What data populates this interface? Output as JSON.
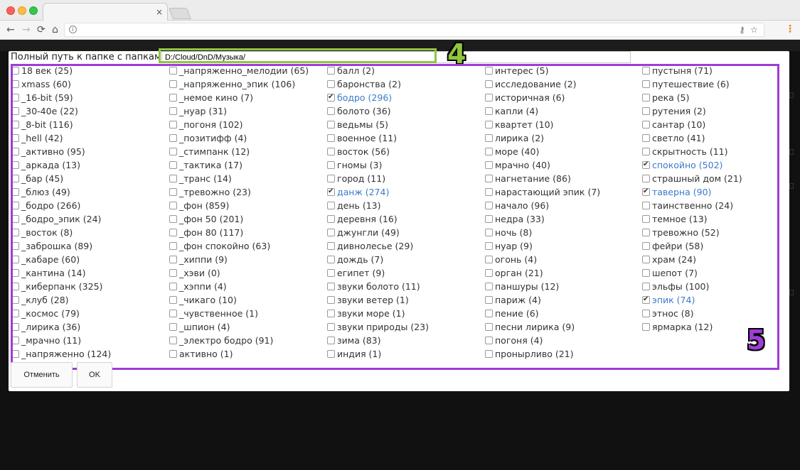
{
  "browser": {
    "tab_close": "×",
    "nav": {
      "back": "←",
      "forward": "→",
      "reload": "⟳",
      "home": "⌂"
    },
    "info": "i",
    "key_icon": "⚷",
    "star_icon": "☆",
    "menu_icon": "⋮"
  },
  "dialog": {
    "path_label": "Полный путь к папке с папками",
    "path_value": "D:/Cloud/DnD/Музыка/",
    "annotation_4": "4",
    "annotation_5": "5",
    "cancel_label": "Отменить",
    "ok_label": "OK",
    "annotation_colors": {
      "label4": "#8ec63f",
      "label5": "#9f3cd6"
    }
  },
  "columns": [
    [
      {
        "label": "18 век (25)",
        "checked": false
      },
      {
        "label": "xmass (60)",
        "checked": false
      },
      {
        "label": "_16-bit (59)",
        "checked": false
      },
      {
        "label": "_30-40е (22)",
        "checked": false
      },
      {
        "label": "_8-bit (116)",
        "checked": false
      },
      {
        "label": "_hell (42)",
        "checked": false
      },
      {
        "label": "_активно (95)",
        "checked": false
      },
      {
        "label": "_аркада (13)",
        "checked": false
      },
      {
        "label": "_бар (45)",
        "checked": false
      },
      {
        "label": "_блюз (49)",
        "checked": false
      },
      {
        "label": "_бодро (266)",
        "checked": false
      },
      {
        "label": "_бодро_эпик (24)",
        "checked": false
      },
      {
        "label": "_восток (8)",
        "checked": false
      },
      {
        "label": "_заброшка (89)",
        "checked": false
      },
      {
        "label": "_кабаре (60)",
        "checked": false
      },
      {
        "label": "_кантина (14)",
        "checked": false
      },
      {
        "label": "_киберпанк (325)",
        "checked": false
      },
      {
        "label": "_клуб (28)",
        "checked": false
      },
      {
        "label": "_космос (79)",
        "checked": false
      },
      {
        "label": "_лирика (36)",
        "checked": false
      },
      {
        "label": "_мрачно (11)",
        "checked": false
      },
      {
        "label": "_напряженно (124)",
        "checked": false
      }
    ],
    [
      {
        "label": "_напряженно_мелодии (65)",
        "checked": false
      },
      {
        "label": "_напряженно_эпик (106)",
        "checked": false
      },
      {
        "label": "_немое кино (7)",
        "checked": false
      },
      {
        "label": "_нуар (31)",
        "checked": false
      },
      {
        "label": "_погоня (102)",
        "checked": false
      },
      {
        "label": "_позитифф (4)",
        "checked": false
      },
      {
        "label": "_стимпанк (12)",
        "checked": false
      },
      {
        "label": "_тактика (17)",
        "checked": false
      },
      {
        "label": "_транс (14)",
        "checked": false
      },
      {
        "label": "_тревожно (23)",
        "checked": false
      },
      {
        "label": "_фон (859)",
        "checked": false
      },
      {
        "label": "_фон 50 (201)",
        "checked": false
      },
      {
        "label": "_фон 80 (117)",
        "checked": false
      },
      {
        "label": "_фон спокойно (63)",
        "checked": false
      },
      {
        "label": "_хиппи (9)",
        "checked": false
      },
      {
        "label": "_хэви (0)",
        "checked": false
      },
      {
        "label": "_хэппи (4)",
        "checked": false
      },
      {
        "label": "_чикаго (10)",
        "checked": false
      },
      {
        "label": "_чувственное (1)",
        "checked": false
      },
      {
        "label": "_шпион (4)",
        "checked": false
      },
      {
        "label": "_электро бодро (91)",
        "checked": false
      },
      {
        "label": "активно (1)",
        "checked": false
      }
    ],
    [
      {
        "label": "балл (2)",
        "checked": false
      },
      {
        "label": "баронства (2)",
        "checked": false
      },
      {
        "label": "бодро (296)",
        "checked": true
      },
      {
        "label": "болото (36)",
        "checked": false
      },
      {
        "label": "ведьмы (5)",
        "checked": false
      },
      {
        "label": "военное (11)",
        "checked": false
      },
      {
        "label": "восток (56)",
        "checked": false
      },
      {
        "label": "гномы (3)",
        "checked": false
      },
      {
        "label": "город (11)",
        "checked": false
      },
      {
        "label": "данж (274)",
        "checked": true
      },
      {
        "label": "день (13)",
        "checked": false
      },
      {
        "label": "деревня (16)",
        "checked": false
      },
      {
        "label": "джунгли (49)",
        "checked": false
      },
      {
        "label": "дивнолесье (29)",
        "checked": false
      },
      {
        "label": "дождь (7)",
        "checked": false
      },
      {
        "label": "египет (9)",
        "checked": false
      },
      {
        "label": "звуки болото (11)",
        "checked": false
      },
      {
        "label": "звуки ветер (1)",
        "checked": false
      },
      {
        "label": "звуки море (1)",
        "checked": false
      },
      {
        "label": "звуки природы (23)",
        "checked": false
      },
      {
        "label": "зима (83)",
        "checked": false
      },
      {
        "label": "индия (1)",
        "checked": false
      }
    ],
    [
      {
        "label": "интерес (5)",
        "checked": false
      },
      {
        "label": "исследование (2)",
        "checked": false
      },
      {
        "label": "историчная (6)",
        "checked": false
      },
      {
        "label": "капли (4)",
        "checked": false
      },
      {
        "label": "квартет (10)",
        "checked": false
      },
      {
        "label": "лирика (2)",
        "checked": false
      },
      {
        "label": "море (40)",
        "checked": false
      },
      {
        "label": "мрачно (40)",
        "checked": false
      },
      {
        "label": "нагнетание (86)",
        "checked": false
      },
      {
        "label": "нарастающий эпик (7)",
        "checked": false
      },
      {
        "label": "начало (96)",
        "checked": false
      },
      {
        "label": "недра (33)",
        "checked": false
      },
      {
        "label": "ночь (8)",
        "checked": false
      },
      {
        "label": "нуар (9)",
        "checked": false
      },
      {
        "label": "огонь (4)",
        "checked": false
      },
      {
        "label": "орган (21)",
        "checked": false
      },
      {
        "label": "паншуры (12)",
        "checked": false
      },
      {
        "label": "париж (4)",
        "checked": false
      },
      {
        "label": "пение (6)",
        "checked": false
      },
      {
        "label": "песни лирика (9)",
        "checked": false
      },
      {
        "label": "погоня (4)",
        "checked": false
      },
      {
        "label": "пронырливо (21)",
        "checked": false
      }
    ],
    [
      {
        "label": "пустыня (71)",
        "checked": false
      },
      {
        "label": "путешествие (6)",
        "checked": false
      },
      {
        "label": "река (5)",
        "checked": false
      },
      {
        "label": "рутения (2)",
        "checked": false
      },
      {
        "label": "сантар (10)",
        "checked": false
      },
      {
        "label": "светло (41)",
        "checked": false
      },
      {
        "label": "скрытность (11)",
        "checked": false
      },
      {
        "label": "спокойно (502)",
        "checked": true
      },
      {
        "label": "страшный дом (21)",
        "checked": false
      },
      {
        "label": "таверна (90)",
        "checked": true
      },
      {
        "label": "таинственно (24)",
        "checked": false
      },
      {
        "label": "темное (13)",
        "checked": false
      },
      {
        "label": "тревожно (52)",
        "checked": false
      },
      {
        "label": "фейри (58)",
        "checked": false
      },
      {
        "label": "храм (24)",
        "checked": false
      },
      {
        "label": "шепот (7)",
        "checked": false
      },
      {
        "label": "эльфы (100)",
        "checked": false
      },
      {
        "label": "эпик (74)",
        "checked": true
      },
      {
        "label": "этнос (8)",
        "checked": false
      },
      {
        "label": "ярмарка (12)",
        "checked": false
      }
    ]
  ]
}
